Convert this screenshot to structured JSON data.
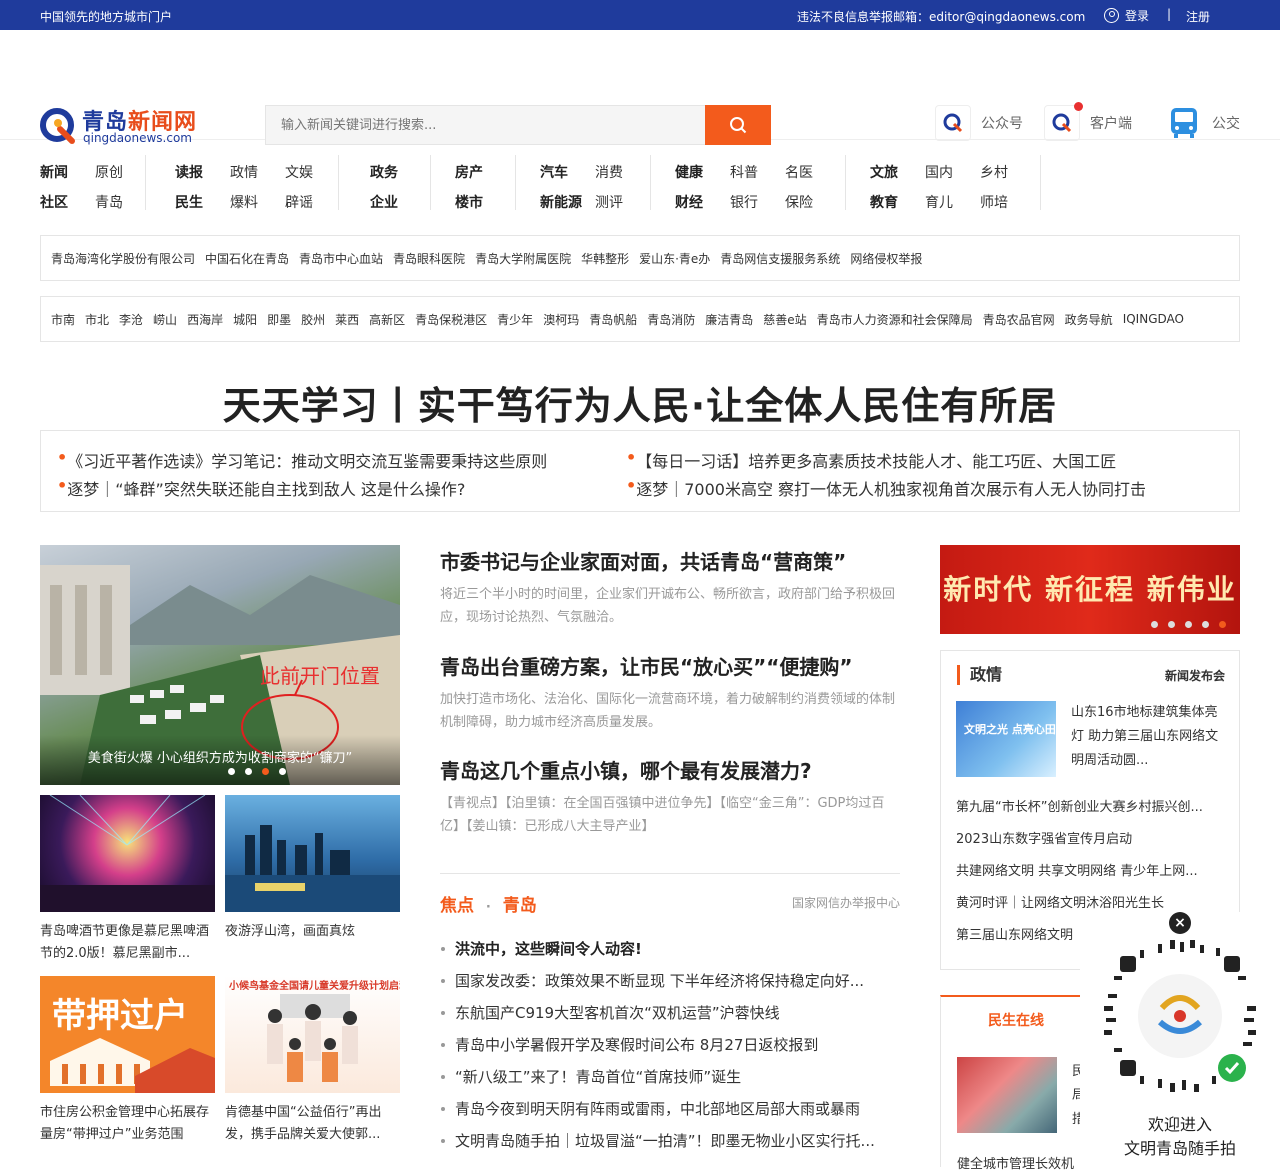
{
  "topbar": {
    "slogan": "中国领先的地方城市门户",
    "report": "违法不良信息举报邮箱：editor@qingdaonews.com",
    "login": "登录",
    "separator": "|",
    "register": "注册"
  },
  "header": {
    "logo_cn_a": "青岛",
    "logo_cn_b": "新闻网",
    "logo_en": "qingdaonews.com",
    "search_placeholder": "输入新闻关键词进行搜索...",
    "links": [
      {
        "label": "公众号",
        "icon": "wechat-account-icon"
      },
      {
        "label": "客户端",
        "icon": "app-client-icon"
      },
      {
        "label": "公交",
        "icon": "bus-icon"
      }
    ]
  },
  "nav": {
    "groups": [
      [
        "新闻",
        "原创",
        "社区",
        "青岛"
      ],
      [
        "读报",
        "政情",
        "文娱",
        "民生",
        "爆料",
        "辟谣"
      ],
      [
        "政务",
        "企业"
      ],
      [
        "房产",
        "楼市"
      ],
      [
        "汽车",
        "消费",
        "新能源",
        "测评"
      ],
      [
        "健康",
        "科普",
        "名医",
        "财经",
        "银行",
        "保险"
      ],
      [
        "文旅",
        "国内",
        "乡村",
        "教育",
        "育儿",
        "师培"
      ]
    ]
  },
  "partner_links": [
    "青岛海湾化学股份有限公司",
    "中国石化在青岛",
    "青岛市中心血站",
    "青岛眼科医院",
    "青岛大学附属医院",
    "华韩整形",
    "爱山东·青e办",
    "青岛网信支援服务系统",
    "网络侵权举报"
  ],
  "district_links": [
    "市南",
    "市北",
    "李沧",
    "崂山",
    "西海岸",
    "城阳",
    "即墨",
    "胶州",
    "莱西",
    "高新区",
    "青岛保税港区",
    "青少年",
    "澳柯玛",
    "青岛帆船",
    "青岛消防",
    "廉洁青岛",
    "慈善e站",
    "青岛市人力资源和社会保障局",
    "青岛农品官网",
    "政务导航",
    "IQINGDAO"
  ],
  "headline": {
    "title": "天天学习丨实干笃行为人民·让全体人民住有所居",
    "items": [
      "《习近平著作选读》学习笔记：推动文明交流互鉴需要秉持这些原则",
      "【每日一习话】培养更多高素质技术技能人才、能工巧匠、大国工匠",
      "逐梦｜“蜂群”突然失联还能自主找到敌人 这是什么操作?",
      "逐梦｜7000米高空 察打一体无人机独家视角首次展示有人无人协同打击"
    ]
  },
  "carousel": {
    "caption": "美食街火爆 小心组织方成为收割商家的“镰刀”",
    "overlay_text": "此前开门位置",
    "active_dot": 3
  },
  "thumbs": [
    {
      "caption": "青岛啤酒节更像是慕尼黑啤酒节的2.0版！慕尼黑副市..."
    },
    {
      "caption": "夜游浮山湾，画面真炫"
    },
    {
      "caption": "市住房公积金管理中心拓展存量房“带押过户”业务范围",
      "overlay": "带押过户"
    },
    {
      "caption": "肯德基中国“公益佰行”再出发，携手品牌关爱大使郭...",
      "overlay": "小候鸟基金全国请儿童关爱升级计划启动"
    }
  ],
  "main_news": [
    {
      "title": "市委书记与企业家面对面，共话青岛“营商策”",
      "desc": "将近三个半小时的时间里，企业家们开诚布公、畅所欲言，政府部门给予积极回应，现场讨论热烈、气氛融洽。"
    },
    {
      "title": "青岛出台重磅方案，让市民“放心买”“便捷购”",
      "desc": "加快打造市场化、法治化、国际化一流营商环境，着力破解制约消费领域的体制机制障碍，助力城市经济高质量发展。"
    },
    {
      "title": "青岛这几个重点小镇，哪个最有发展潜力?",
      "desc": "【青视点】【泊里镇：在全国百强镇中进位争先】【临空“金三角”：GDP均过百亿】【姜山镇：已形成八大主导产业】"
    }
  ],
  "focus": {
    "tab1": "焦点",
    "dot": "·",
    "tab2": "青岛",
    "right": "国家网信办举报中心",
    "items": [
      "洪流中，这些瞬间令人动容!",
      "国家发改委：政策效果不断显现 下半年经济将保持稳定向好...",
      "东航国产C919大型客机首次“双机运营”沪蓉快线",
      "青岛中小学暑假开学及寒假时间公布 8月27日返校报到",
      "“新八级工”来了！青岛首位“首席技师”诞生",
      "青岛今夜到明天阴有阵雨或雷雨，中北部地区局部大雨或暴雨",
      "文明青岛随手拍｜垃圾冒溢“一拍清”！即墨无物业小区实行托..."
    ]
  },
  "banner": {
    "text": "新时代 新征程 新伟业",
    "active_dot": 5
  },
  "zhengqing": {
    "title": "政情",
    "right": "新闻发布会",
    "img_text": "文明之光 点亮心田",
    "feature": "山东16市地标建筑集体亮灯 助力第三届山东网络文明周活动圆...",
    "items": [
      "第九届“市长杯”创新创业大赛乡村振兴创...",
      "2023山东数字强省宣传月启动",
      "共建网络文明 共享文明网络 青少年上网...",
      "黄河时评｜让网络文明沐浴阳光生长",
      "第三届山东网络文明"
    ]
  },
  "minsheng": {
    "title": "民生在线",
    "partial": [
      "民",
      "局",
      "措"
    ],
    "caption": "健全城市管理长效机"
  },
  "qr": {
    "close": "×",
    "line1": "欢迎进入",
    "line2": "文明青岛随手拍"
  },
  "colors": {
    "brand_blue": "#1f3b9c",
    "accent_orange": "#f35b1c",
    "banner_red": "#d0201a"
  }
}
